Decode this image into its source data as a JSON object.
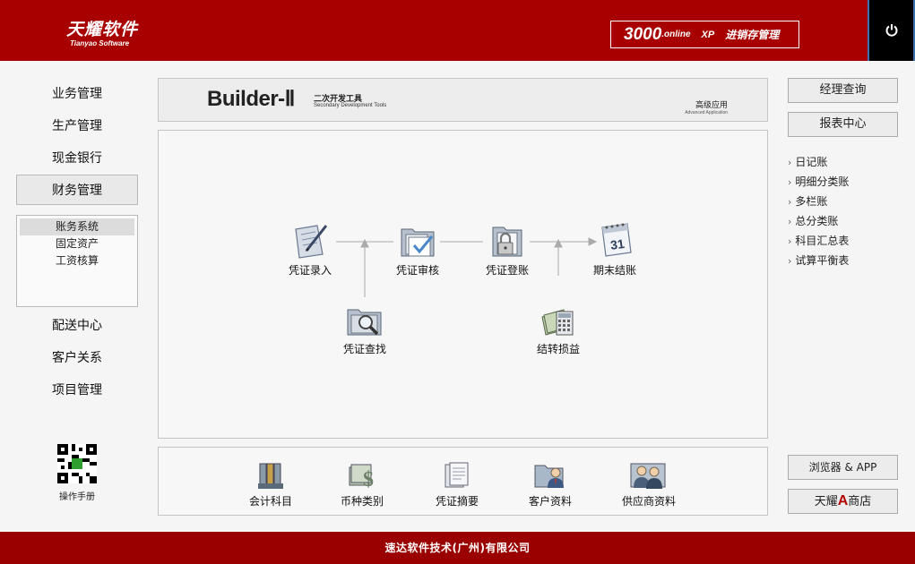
{
  "header": {
    "logo_main": "天耀软件",
    "logo_sub": "Tianyao Software",
    "product_num": "3000",
    "product_online": ".online",
    "product_xp": "XP",
    "product_name": "进销存管理"
  },
  "nav": {
    "items": [
      {
        "label": "业务管理"
      },
      {
        "label": "生产管理"
      },
      {
        "label": "现金银行"
      },
      {
        "label": "财务管理"
      },
      {
        "label": "配送中心"
      },
      {
        "label": "客户关系"
      },
      {
        "label": "项目管理"
      }
    ],
    "active": "财务管理",
    "sub_items": [
      {
        "label": "账务系统"
      },
      {
        "label": "固定资产"
      },
      {
        "label": "工资核算"
      }
    ],
    "qr_label": "操作手册"
  },
  "banner": {
    "title": "Builder-Ⅱ",
    "cn_sub": "二次开发工具",
    "en_sub": "Secondary Development Tools",
    "adv": "高级应用",
    "adv_en": "Advanced Application"
  },
  "flow": {
    "nodes": [
      {
        "label": "凭证录入",
        "icon": "clipboard-pen-icon"
      },
      {
        "label": "凭证审核",
        "icon": "folder-check-icon"
      },
      {
        "label": "凭证登账",
        "icon": "folder-lock-icon"
      },
      {
        "label": "期末结账",
        "icon": "calendar-icon"
      },
      {
        "label": "凭证查找",
        "icon": "folder-search-icon"
      },
      {
        "label": "结转损益",
        "icon": "money-calculator-icon"
      }
    ],
    "calendar_day": "31"
  },
  "tools": [
    {
      "label": "会计科目",
      "icon": "binders-icon"
    },
    {
      "label": "币种类别",
      "icon": "dollar-icon"
    },
    {
      "label": "凭证摘要",
      "icon": "documents-icon"
    },
    {
      "label": "客户资料",
      "icon": "customer-icon"
    },
    {
      "label": "供应商资料",
      "icon": "suppliers-icon"
    }
  ],
  "right": {
    "buttons": [
      {
        "label": "经理查询"
      },
      {
        "label": "报表中心"
      }
    ],
    "links": [
      {
        "label": "日记账"
      },
      {
        "label": "明细分类账"
      },
      {
        "label": "多栏账"
      },
      {
        "label": "总分类账"
      },
      {
        "label": "科目汇总表"
      },
      {
        "label": "试算平衡表"
      }
    ],
    "browser_btn": "浏览器 & APP",
    "shop_prefix": "天耀",
    "shop_a": "A",
    "shop_suffix": "商店"
  },
  "footer": {
    "text": "速达软件技术(广州)有限公司"
  },
  "colors": {
    "header_red": "#a80000",
    "footer_red": "#9b0000"
  }
}
